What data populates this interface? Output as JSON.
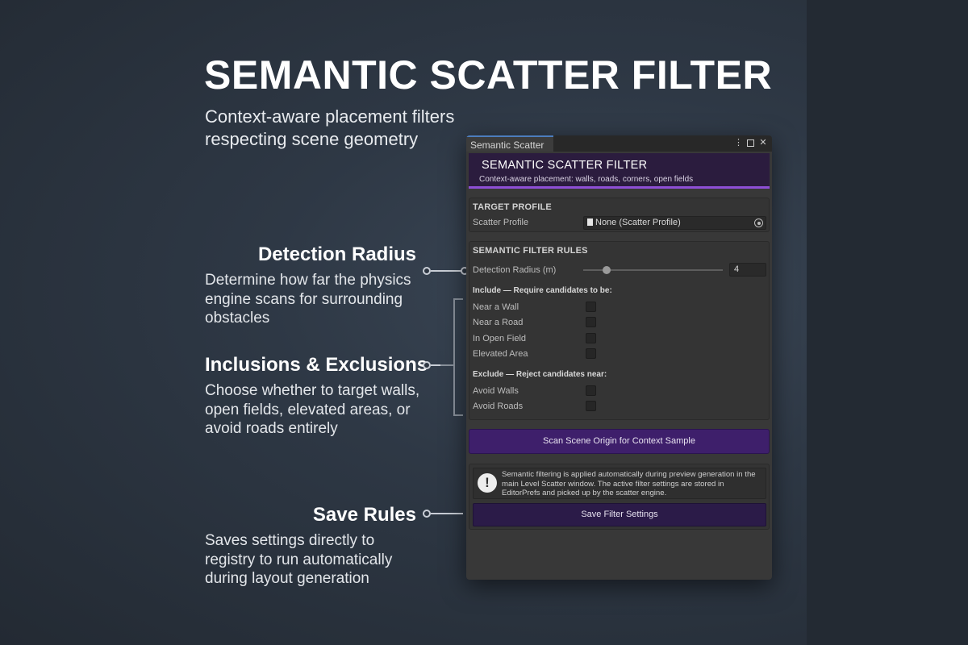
{
  "marketing": {
    "headline": "SEMANTIC SCATTER FILTER",
    "subhead": "Context-aware placement filters respecting scene geometry",
    "callouts": [
      {
        "title": "Detection Radius",
        "desc": "Determine how far the physics engine scans for surrounding obstacles"
      },
      {
        "title": "Inclusions & Exclusions",
        "desc": "Choose whether to target walls, open fields, elevated areas, or avoid roads entirely"
      },
      {
        "title": "Save Rules",
        "desc": "Saves settings directly to registry to run automatically during layout generation"
      }
    ]
  },
  "window": {
    "tab_title": "Semantic Scatter",
    "controls": {
      "menu": "⋮",
      "close": "✕"
    },
    "header": {
      "title": "SEMANTIC SCATTER FILTER",
      "subtitle": "Context-aware placement: walls, roads, corners, open fields",
      "accent_color": "#8e4fd6"
    },
    "target_profile": {
      "section_title": "TARGET PROFILE",
      "label": "Scatter Profile",
      "value": "None (Scatter Profile)",
      "icons": [
        "file-icon",
        "object-picker-icon"
      ]
    },
    "filter_rules": {
      "section_title": "SEMANTIC FILTER RULES",
      "radius_label": "Detection Radius (m)",
      "radius_value": "4",
      "slider_fraction": 0.17,
      "include_heading": "Include — Require candidates to be:",
      "include_items": [
        {
          "label": "Near a Wall",
          "checked": false
        },
        {
          "label": "Near a Road",
          "checked": false
        },
        {
          "label": "In Open Field",
          "checked": false
        },
        {
          "label": "Elevated Area",
          "checked": false
        }
      ],
      "exclude_heading": "Exclude — Reject candidates near:",
      "exclude_items": [
        {
          "label": "Avoid Walls",
          "checked": false
        },
        {
          "label": "Avoid Roads",
          "checked": false
        }
      ]
    },
    "scan_button": "Scan Scene Origin for Context Sample",
    "help": {
      "icon": "!",
      "text": "Semantic filtering is applied automatically during preview generation in the main Level Scatter window. The active filter settings are stored in EditorPrefs and picked up by the scatter engine."
    },
    "save_button": "Save Filter Settings"
  }
}
